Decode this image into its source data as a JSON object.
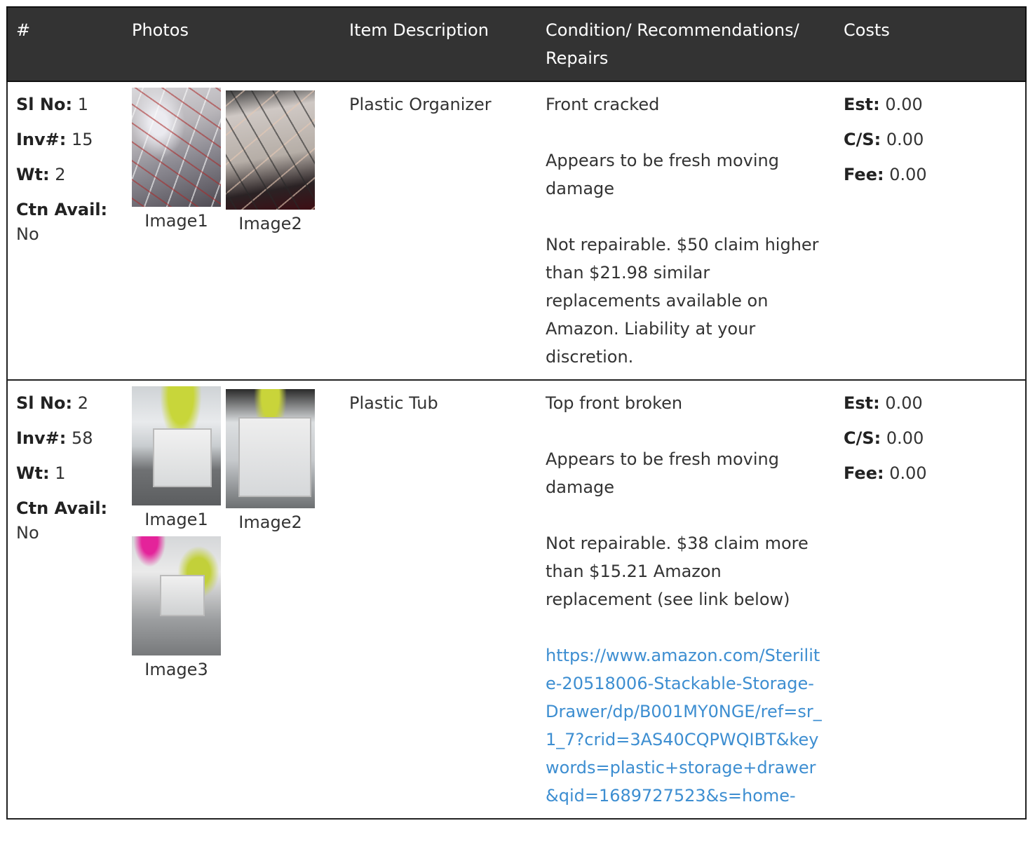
{
  "headers": [
    "#",
    "Photos",
    "Item Description",
    "Condition/ Recommendations/ Repairs",
    "Costs"
  ],
  "labels": {
    "sl_no": "Sl No:",
    "inv": "Inv#:",
    "wt": "Wt:",
    "ctn_avail": "Ctn Avail:",
    "est": "Est:",
    "cs": "C/S:",
    "fee": "Fee:"
  },
  "rows": [
    {
      "sl_no": "1",
      "inv": "15",
      "wt": "2",
      "ctn_avail": "No",
      "photos": [
        "Image1",
        "Image2"
      ],
      "description": "Plastic Organizer",
      "condition": [
        "Front cracked",
        "Appears to be fresh moving damage",
        "Not repairable. $50 claim higher than $21.98 similar replacements available on Amazon. Liability at your discretion."
      ],
      "link": "",
      "est": "0.00",
      "cs": "0.00",
      "fee": "0.00"
    },
    {
      "sl_no": "2",
      "inv": "58",
      "wt": "1",
      "ctn_avail": "No",
      "photos": [
        "Image1",
        "Image2",
        "Image3"
      ],
      "description": "Plastic Tub",
      "condition": [
        "Top front broken",
        "Appears to be fresh moving damage",
        "Not repairable. $38 claim more than $15.21 Amazon replacement (see link below)"
      ],
      "link": "https://www.amazon.com/Sterilite-20518006-Stackable-Storage-Drawer/dp/B001MY0NGE/ref=sr_1_7?crid=3AS40CQPWQIBT&keywords=plastic+storage+drawer&qid=1689727523&s=home-",
      "est": "0.00",
      "cs": "0.00",
      "fee": "0.00"
    }
  ],
  "colors": {
    "header_bg": "#333333",
    "header_text": "#ffffff",
    "link": "#3d8ed1",
    "border": "#222222"
  }
}
